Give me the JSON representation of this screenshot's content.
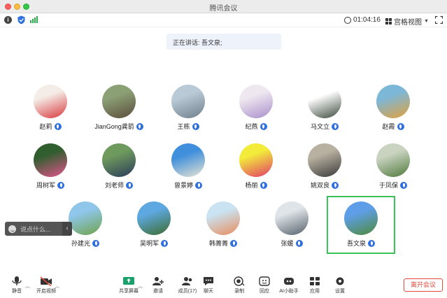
{
  "window": {
    "title": "腾讯会议"
  },
  "topbar": {
    "timer": "01:04:16",
    "view_label": "宫格视图"
  },
  "speaking": {
    "label": "正在讲话:",
    "name": "吾文泉;"
  },
  "participants": [
    {
      "name": "赵莉",
      "colors": [
        "#f4ece6",
        "#d9383e"
      ]
    },
    {
      "name": "JianGong龚箭",
      "colors": [
        "#8ba074",
        "#5b4b3c"
      ]
    },
    {
      "name": "王栋",
      "colors": [
        "#b9c9d6",
        "#6f7f8a"
      ]
    },
    {
      "name": "纪燕",
      "colors": [
        "#eee7ef",
        "#a98ecb"
      ]
    },
    {
      "name": "马文立",
      "colors": [
        "#ffffff",
        "#3c4a3c"
      ]
    },
    {
      "name": "赵霞",
      "colors": [
        "#7db7d8",
        "#e1a13c"
      ]
    },
    {
      "name": "周树军",
      "colors": [
        "#305e2f",
        "#e4548d"
      ]
    },
    {
      "name": "刘老师",
      "colors": [
        "#6f9a5d",
        "#2a3a5a"
      ]
    },
    {
      "name": "曾景婷",
      "colors": [
        "#3f8fdc",
        "#e8e4d2"
      ]
    },
    {
      "name": "杨丽",
      "colors": [
        "#f2eb3a",
        "#e23a6a"
      ]
    },
    {
      "name": "姚双良",
      "colors": [
        "#b8b0a0",
        "#3a3a3a"
      ]
    },
    {
      "name": "于凤保",
      "colors": [
        "#c9d3c0",
        "#4f7a3c"
      ]
    },
    {
      "name": "孙建光",
      "colors": [
        "#8fc6ea",
        "#6fa34a"
      ]
    },
    {
      "name": "吴明军",
      "colors": [
        "#5da8e0",
        "#3d6b2c"
      ]
    },
    {
      "name": "韩菁菁",
      "colors": [
        "#c9e3f2",
        "#e98c5c"
      ]
    },
    {
      "name": "张媛",
      "colors": [
        "#dfe4e8",
        "#55616b"
      ]
    },
    {
      "name": "吾文泉",
      "colors": [
        "#5e9ee8",
        "#4e8a3a"
      ]
    }
  ],
  "chat": {
    "placeholder": "说点什么..."
  },
  "toolbar": {
    "items": [
      {
        "label": "静音",
        "icon": "microphone-icon"
      },
      {
        "label": "开启视频",
        "icon": "video-camera-icon"
      },
      {
        "label": "共享屏幕",
        "icon": "share-screen-icon"
      },
      {
        "label": "邀请",
        "icon": "invite-icon"
      },
      {
        "label": "成员(17)",
        "icon": "members-icon"
      },
      {
        "label": "聊天",
        "icon": "chat-icon"
      },
      {
        "label": "录制",
        "icon": "record-icon"
      },
      {
        "label": "回应",
        "icon": "react-icon"
      },
      {
        "label": "AI小助手",
        "icon": "ai-assistant-icon"
      },
      {
        "label": "应用",
        "icon": "apps-icon"
      },
      {
        "label": "设置",
        "icon": "settings-icon"
      }
    ],
    "end_label": "离开会议"
  },
  "colors": {
    "accent": "#2f6fe0",
    "active_speaker_border": "#3cc25b",
    "end_button": "#e14a3c"
  }
}
